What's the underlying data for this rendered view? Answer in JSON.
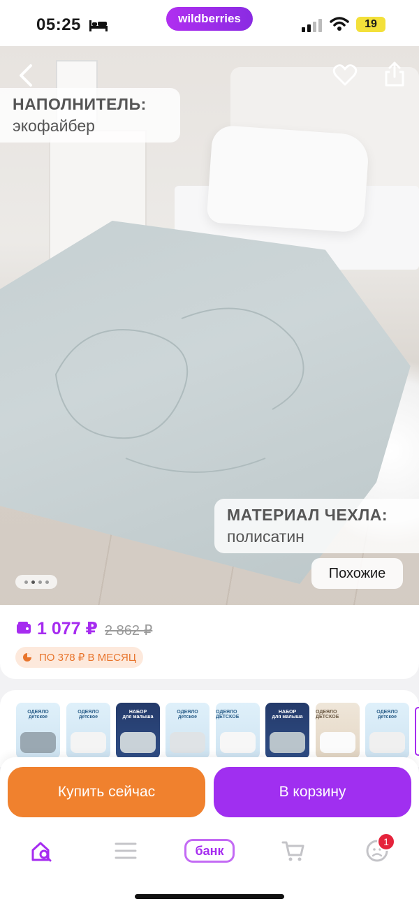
{
  "status_bar": {
    "time": "05:25",
    "app_name": "wildberries",
    "battery": "19"
  },
  "product": {
    "filler_title": "НАПОЛНИТЕЛЬ:",
    "filler_value": "экофайбер",
    "cover_title": "МАТЕРИАЛ ЧЕХЛА:",
    "cover_value": "полисатин",
    "similar_label": "Похожие",
    "gallery_pages": 4,
    "gallery_current": 2
  },
  "price": {
    "current": "1 077 ₽",
    "old": "2 862 ₽",
    "installment": "ПО 378 ₽ В МЕСЯЦ"
  },
  "thumbnails": [
    {
      "label": "ОДЕЯЛО",
      "sub": "детское",
      "style": "light"
    },
    {
      "label": "ОДЕЯЛО",
      "sub": "детское",
      "style": "light"
    },
    {
      "label": "НАБОР",
      "sub": "для малыша",
      "style": "dark"
    },
    {
      "label": "ОДЕЯЛО",
      "sub": "детское",
      "style": "light"
    },
    {
      "label": "ОДЕЯЛО ДЕТСКОЕ",
      "sub": "",
      "style": "light"
    },
    {
      "label": "НАБОР",
      "sub": "для малыша",
      "style": "dark"
    },
    {
      "label": "ОДЕЯЛО ДЕТСКОЕ",
      "sub": "",
      "style": "cream"
    },
    {
      "label": "ОДЕЯЛО",
      "sub": "детское",
      "style": "light"
    }
  ],
  "actions": {
    "buy_now": "Купить сейчас",
    "add_to_cart": "В корзину"
  },
  "tabbar": {
    "bank_label": "банк",
    "profile_badge": "1"
  },
  "colors": {
    "accent": "#a62cf0",
    "buy": "#f0812e",
    "cart": "#a02ff0",
    "installment": "#e8742b"
  }
}
